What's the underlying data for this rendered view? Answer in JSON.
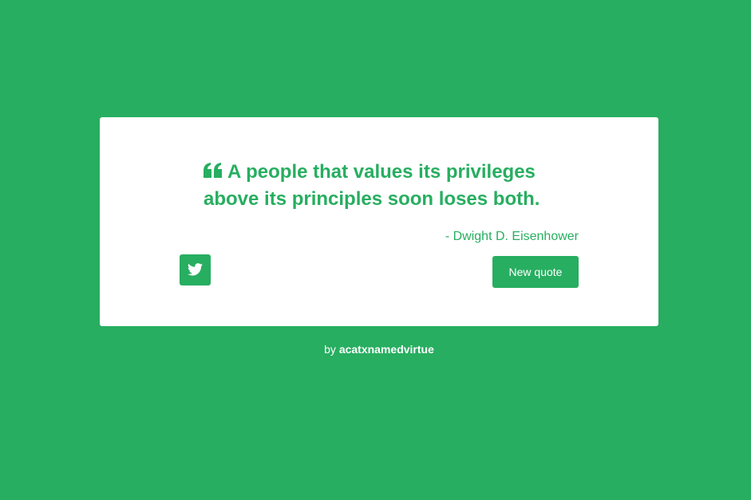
{
  "quote": {
    "text": "A people that values its privileges above its principles soon loses both.",
    "author": "- Dwight D. Eisenhower"
  },
  "actions": {
    "tweet_icon": "twitter-icon",
    "new_quote_label": "New quote"
  },
  "footer": {
    "prefix": "by ",
    "link_text": "acatxnamedvirtue"
  },
  "colors": {
    "background": "#27ae60",
    "card": "#ffffff",
    "accent": "#27ae60"
  }
}
